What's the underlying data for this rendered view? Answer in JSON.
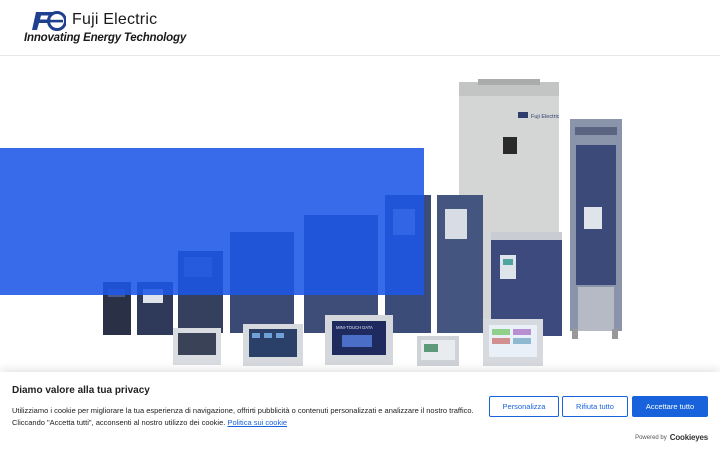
{
  "header": {
    "brand_name": "Fuji Electric",
    "tagline": "Innovating Energy Technology",
    "logo_icon": "fuji-electric-fe-logo"
  },
  "hero": {
    "band_color": "#1d57e6",
    "image_description_icon": "inverter-product-lineup-image",
    "cabinet_nameplate": "Fuji Electric",
    "device_screen_text": "MINI-TOUCH DATA"
  },
  "cookie_banner": {
    "title": "Diamo valore alla tua privacy",
    "text": "Utilizziamo i cookie per migliorare la tua esperienza di navigazione, offrirti pubblicità o contenuti personalizzati e analizzare il nostro traffico. Cliccando \"Accetta tutti\", acconsenti al nostro utilizzo dei cookie.",
    "policy_link": "Politica sui cookie",
    "buttons": {
      "customize": "Personalizza",
      "reject": "Rifiuta tutto",
      "accept": "Accettare tutto"
    },
    "powered_by": "Powered by",
    "powered_brand": "Cookieyes",
    "accent_color": "#1863dc"
  }
}
